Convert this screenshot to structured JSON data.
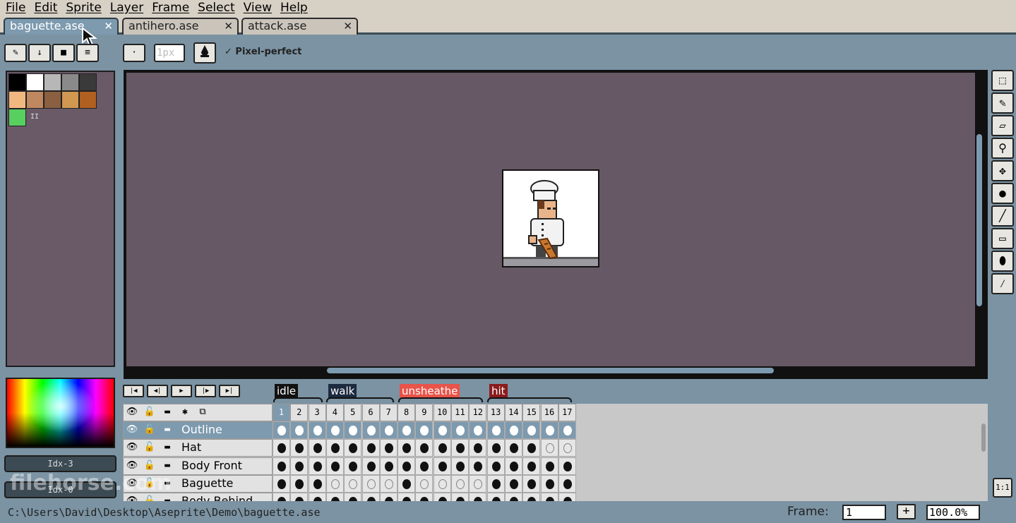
{
  "menu": [
    "File",
    "Edit",
    "Sprite",
    "Layer",
    "Frame",
    "Select",
    "View",
    "Help"
  ],
  "tabs": [
    {
      "label": "baguette.ase",
      "active": true
    },
    {
      "label": "antihero.ase",
      "active": false
    },
    {
      "label": "attack.ase",
      "active": false
    }
  ],
  "close_glyph": "✕",
  "brush_size": "1px",
  "pixel_perfect_label": "Pixel-perfect",
  "palette": {
    "colors": [
      "#000000",
      "#ffffff",
      "#b7b7b7",
      "#8a8a8a",
      "#4a4a4a",
      "#3a3a3a",
      "#f0b880",
      "#c08860",
      "#8a6040",
      "#d09850",
      "#b06020",
      "#58d060"
    ],
    "marker": "II"
  },
  "index_buttons": {
    "fg": "Idx-3",
    "bg": "Idx-0"
  },
  "tags": [
    {
      "label": "idle",
      "color": "#111111"
    },
    {
      "label": "walk",
      "color": "#1c2a40"
    },
    {
      "label": "unsheathe",
      "color": "#e8544a"
    },
    {
      "label": "hit",
      "color": "#8a1c1c"
    }
  ],
  "frames": [
    "1",
    "2",
    "3",
    "4",
    "5",
    "6",
    "7",
    "8",
    "9",
    "10",
    "11",
    "12",
    "13",
    "14",
    "15",
    "16",
    "17"
  ],
  "layers": [
    {
      "name": "Outline"
    },
    {
      "name": "Hat"
    },
    {
      "name": "Body Front"
    },
    {
      "name": "Baguette"
    },
    {
      "name": "Body Behind"
    }
  ],
  "status": {
    "path": "C:\\Users\\David\\Desktop\\Aseprite\\Demo\\baguette.ase",
    "frame_label": "Frame:",
    "frame_value": "1",
    "add_glyph": "+",
    "zoom": "100.0%"
  },
  "one_to_one": "1:1",
  "watermark": "filehorse.com"
}
